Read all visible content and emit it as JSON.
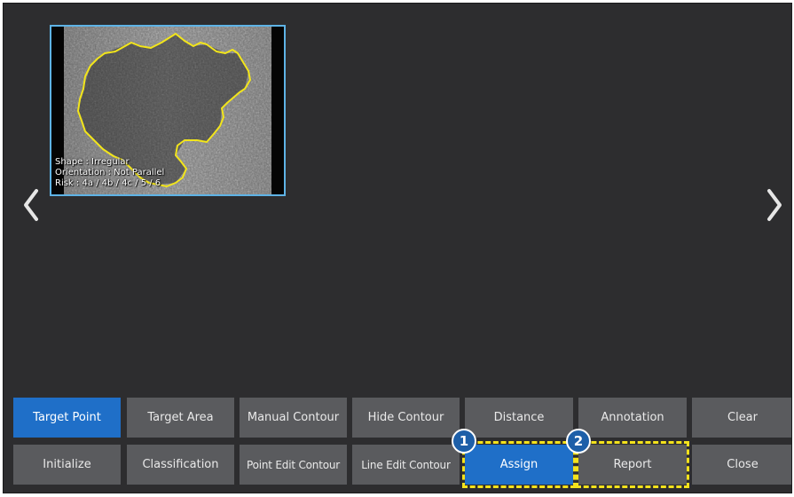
{
  "image": {
    "overlay_lines": [
      "Shape : Irregular",
      "Orientation : Not Parallel",
      "Risk : 4a / 4b / 4c / 5 / 6"
    ],
    "contour_color": "#f2e51b",
    "border_color": "#5eb3e6"
  },
  "nav": {
    "prev_icon": "chevron-left-icon",
    "next_icon": "chevron-right-icon"
  },
  "toolbar": {
    "row1": [
      {
        "label": "Target Point",
        "active": true
      },
      {
        "label": "Target Area"
      },
      {
        "label": "Manual Contour"
      },
      {
        "label": "Hide Contour"
      },
      {
        "label": "Distance"
      },
      {
        "label": "Annotation"
      },
      {
        "label": "Clear"
      }
    ],
    "row2": [
      {
        "label": "Initialize"
      },
      {
        "label": "Classification"
      },
      {
        "label": "Point Edit Contour"
      },
      {
        "label": "Line Edit Contour"
      },
      {
        "label": "Assign",
        "active": true
      },
      {
        "label": "Report"
      },
      {
        "label": "Close"
      }
    ]
  },
  "callouts": [
    {
      "number": "1",
      "target": "Assign"
    },
    {
      "number": "2",
      "target": "Report"
    }
  ],
  "colors": {
    "background": "#2d2d2f",
    "button": "#5a5b5e",
    "button_active": "#1f6fc8",
    "highlight": "#f4e21c",
    "badge": "#1d5fa8"
  }
}
